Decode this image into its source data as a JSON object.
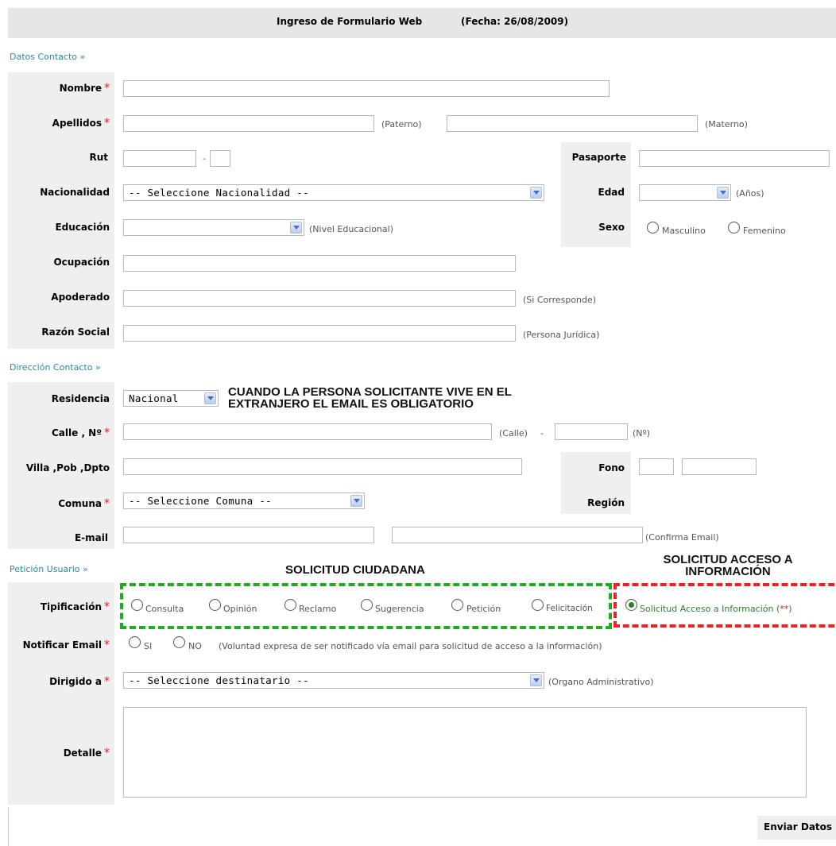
{
  "header": {
    "title": "Ingreso de Formulario Web",
    "date": "(Fecha: 26/08/2009)"
  },
  "sections": {
    "datos_contacto": "Datos Contacto »",
    "direccion_contacto": "Dirección Contacto »",
    "peticion_usuario": "Petición Usuario »"
  },
  "required_mark": "*",
  "fields": {
    "nombre": {
      "label": "Nombre",
      "value": ""
    },
    "apellidos": {
      "label": "Apellidos",
      "paterno_hint": "(Paterno)",
      "materno_hint": "(Materno)"
    },
    "rut": {
      "label": "Rut",
      "separator": "-"
    },
    "pasaporte": {
      "label": "Pasaporte"
    },
    "nacionalidad": {
      "label": "Nacionalidad",
      "selected": "-- Seleccione Nacionalidad --"
    },
    "edad": {
      "label": "Edad",
      "selected": "",
      "hint": "(Años)"
    },
    "educacion": {
      "label": "Educación",
      "selected": "",
      "hint": "(Nivel Educacional)"
    },
    "sexo": {
      "label": "Sexo",
      "options": [
        "Masculino",
        "Femenino"
      ]
    },
    "ocupacion": {
      "label": "Ocupación"
    },
    "apoderado": {
      "label": "Apoderado",
      "hint": "(Si Corresponde)"
    },
    "razon_social": {
      "label": "Razón Social",
      "hint": "(Persona Jurídica)"
    },
    "residencia": {
      "label": "Residencia",
      "selected": "Nacional"
    },
    "calle": {
      "label": "Calle , Nº",
      "calle_hint": "(Calle)",
      "sep": "-",
      "num_hint": "(Nº)"
    },
    "villa": {
      "label": "Villa ,Pob ,Dpto"
    },
    "fono": {
      "label": "Fono"
    },
    "comuna": {
      "label": "Comuna",
      "selected": "-- Seleccione Comuna --"
    },
    "region": {
      "label": "Región"
    },
    "email": {
      "label": "E-mail",
      "confirm_hint": "(Confirma Email)"
    },
    "tipificacion": {
      "label": "Tipificación",
      "options": [
        "Consulta",
        "Opinión",
        "Reclamo",
        "Sugerencia",
        "Petición",
        "Felicitación"
      ],
      "solicitud": "Solicitud Acceso a Información (",
      "solicitud_stars": "**",
      "solicitud_close": ")"
    },
    "notificar": {
      "label": "Notificar Email",
      "options": [
        "SI",
        "NO"
      ],
      "hint": "(Voluntad expresa de ser notificado vía email para solicitud de acceso a la información)"
    },
    "dirigido": {
      "label": "Dirigido a",
      "selected": "-- Seleccione destinatario --",
      "hint": "(Organo Administrativo)"
    },
    "detalle": {
      "label": "Detalle"
    }
  },
  "annotations": {
    "residencia_line1": "CUANDO LA PERSONA SOLICITANTE VIVE EN EL",
    "residencia_line2": "EXTRANJERO EL EMAIL ES OBLIGATORIO",
    "solicitud_ciudadana": "SOLICITUD CIUDADANA",
    "solicitud_acceso_line1": "SOLICITUD ACCESO A",
    "solicitud_acceso_line2": "INFORMACIÓN"
  },
  "submit_label": "Enviar Datos",
  "colors": {
    "section": "#2a8aa8",
    "required": "#d02020",
    "green_dash": "#22aa22",
    "red_dash": "#ee2222",
    "band": "#efefef"
  }
}
